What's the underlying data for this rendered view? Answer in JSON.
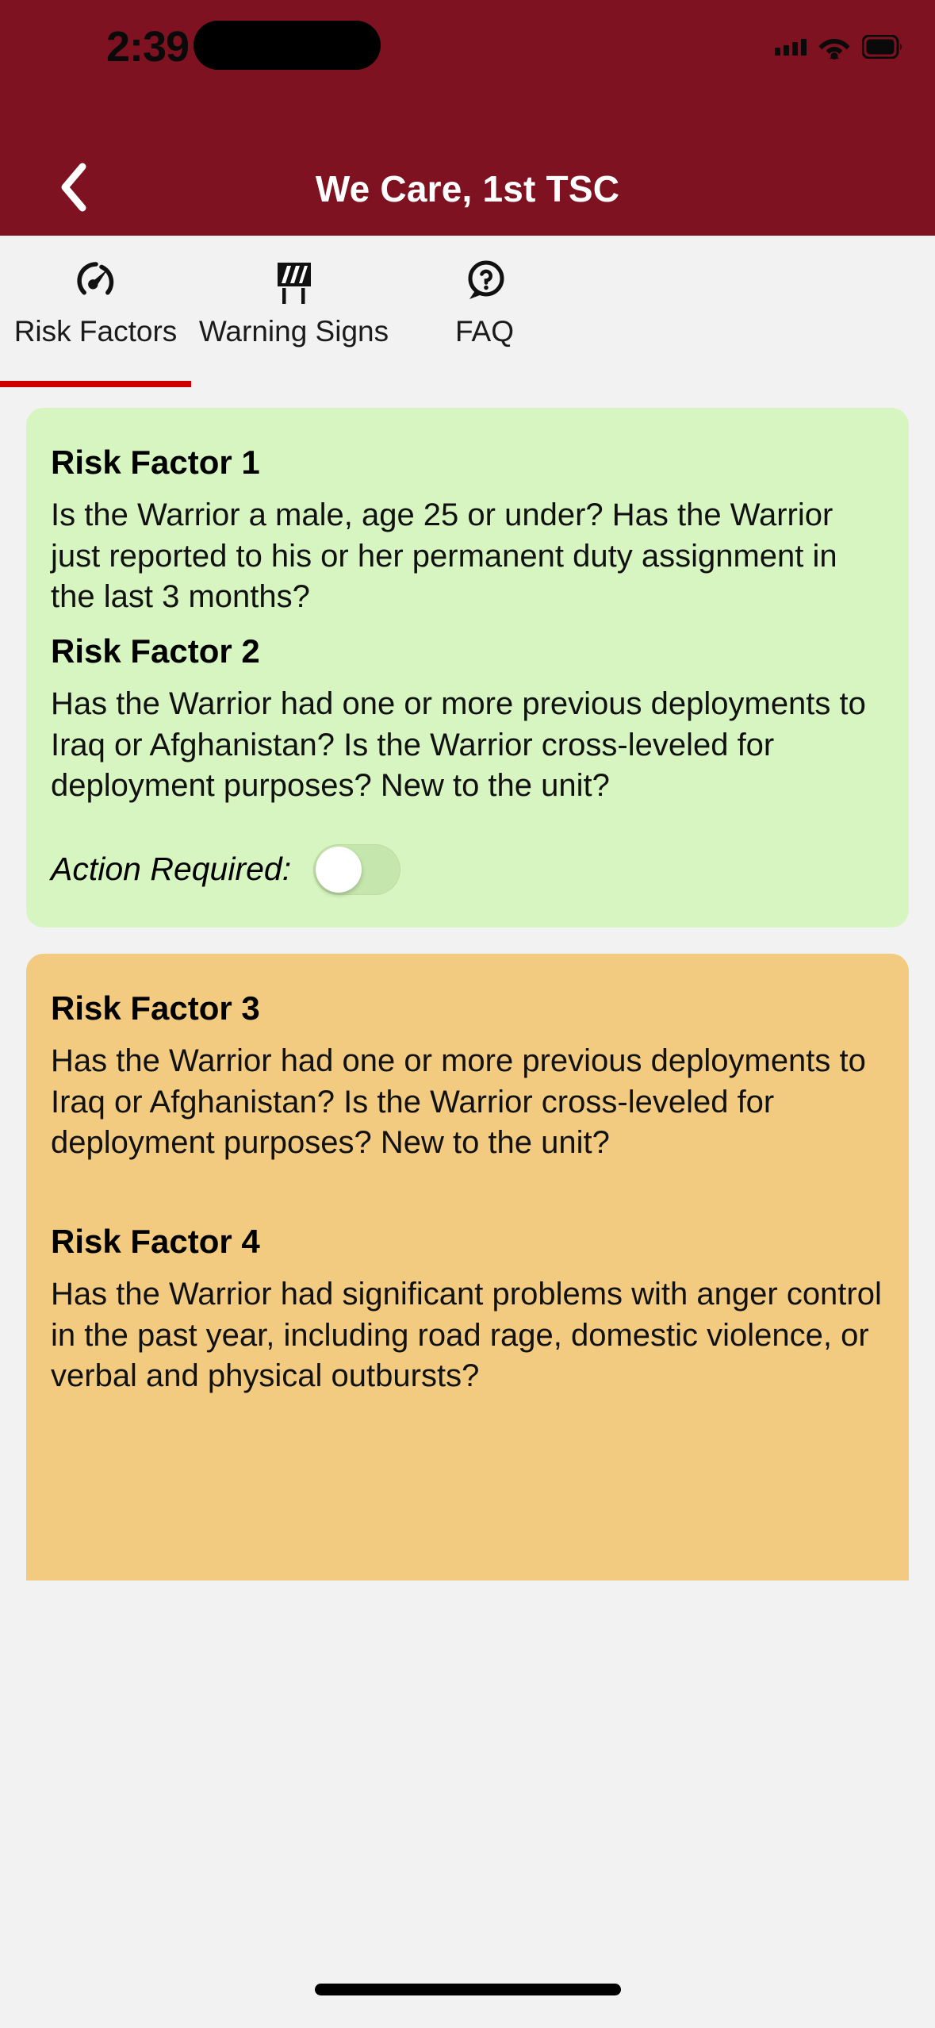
{
  "status_bar": {
    "time": "2:39",
    "signal_icon": "cellular-signal-icon",
    "wifi_icon": "wifi-icon",
    "battery_icon": "battery-icon"
  },
  "header": {
    "back_icon": "chevron-left-icon",
    "title": "We Care, 1st TSC",
    "background_color": "#7E1220",
    "title_color": "#FFFFFF"
  },
  "tabs": {
    "active_index": 0,
    "indicator_color": "#CC0000",
    "items": [
      {
        "label": "Risk Factors",
        "icon": "speedometer-icon"
      },
      {
        "label": "Warning Signs",
        "icon": "road-barrier-icon"
      },
      {
        "label": "FAQ",
        "icon": "question-speech-bubble-icon"
      }
    ]
  },
  "cards": [
    {
      "background_color": "#D7F5C0",
      "factors": [
        {
          "title": "Risk Factor 1",
          "body": "Is the Warrior a male, age 25 or under? Has the Warrior just reported to his or her permanent duty assignment in the last 3 months?"
        },
        {
          "title": "Risk Factor 2",
          "body": "Has the Warrior had one or more previous deployments to Iraq or Afghanistan? Is the Warrior cross-leveled for deployment purposes? New to the unit?"
        }
      ],
      "action": {
        "label": "Action Required:",
        "toggle_on": false
      }
    },
    {
      "background_color": "#F2CB81",
      "factors": [
        {
          "title": "Risk Factor 3",
          "body": "Has the Warrior had one or more previous deployments to Iraq or Afghanistan? Is the Warrior cross-leveled for deployment purposes? New to the unit?"
        },
        {
          "title": "Risk Factor 4",
          "body": "Has the Warrior had significant problems with anger control in the past year, including road rage, domestic violence, or verbal and physical outbursts?"
        }
      ]
    }
  ],
  "home_indicator": "home-indicator"
}
